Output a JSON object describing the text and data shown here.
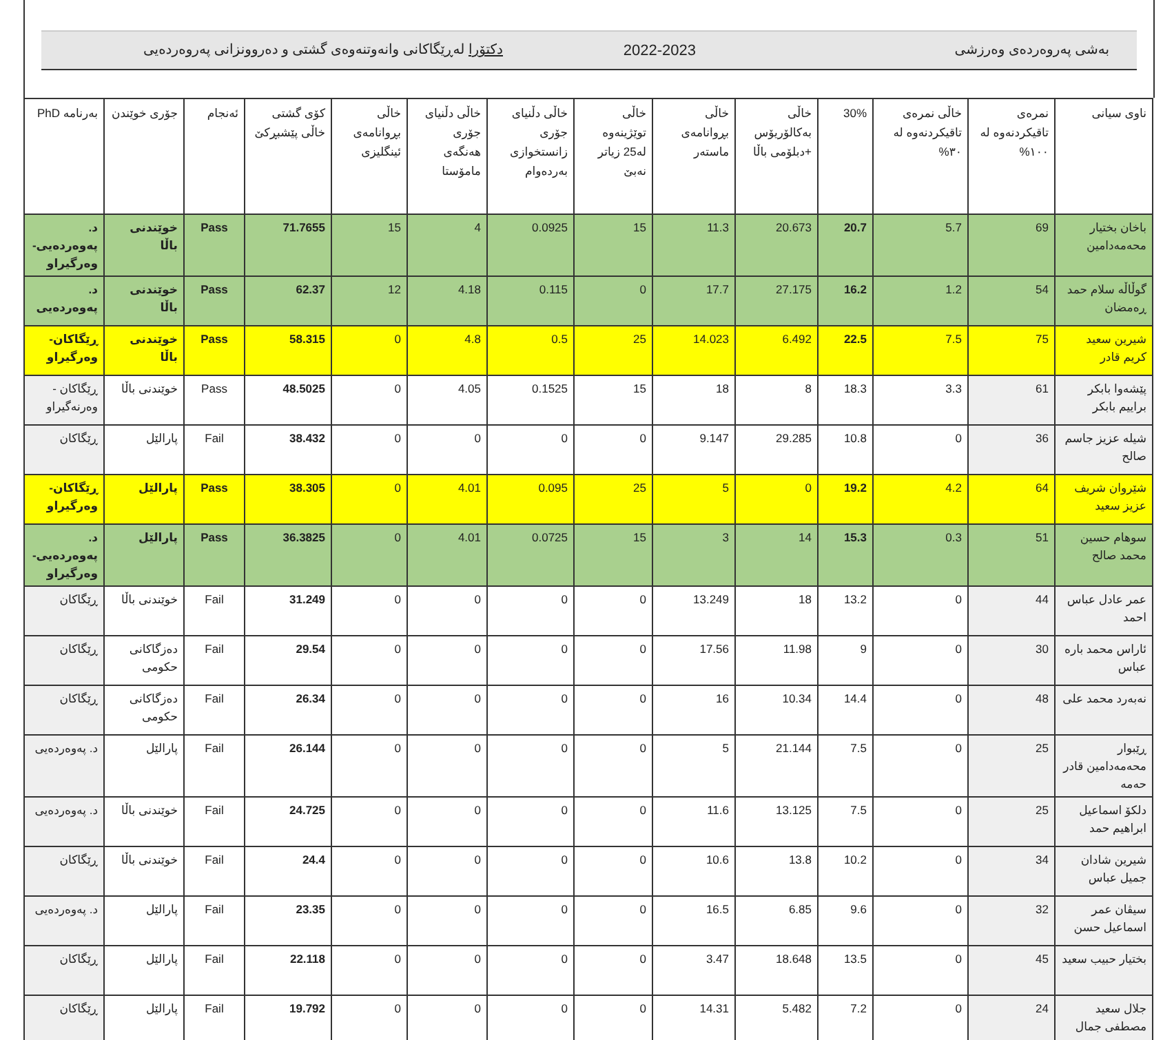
{
  "title_bar": {
    "department": "بەشی پەروەردەی وەرزشی",
    "year": "2022-2023",
    "degree": "دکتۆرا",
    "specialty": "لەڕێگاکانی وانەوتنەوەی گشتی و دەروونزانی پەروەردەیی"
  },
  "table": {
    "columns": [
      "ناوی سیانی",
      "نمرەی تاقیکردنەوە لە ١٠٠%",
      "خاڵی نمرەی تاقیکردنەوە لە ٣٠%",
      "30%",
      "خاڵی بەکالۆریۆس +دبلۆمی باڵا",
      "خاڵی بڕوانامەی ماستەر",
      "خاڵی توێژینەوە لە25 زیاتر نەبێ",
      "خاڵی دڵنیای جۆری زانستخوازی بەردەوام",
      "خاڵی دڵنیای جۆری هەنگەی مامۆستا",
      "خاڵی بڕوانامەی ئینگلیزی",
      "کۆی گشتی خاڵی پێشبڕکێ",
      "ئەنجام",
      "جۆری خوێندن",
      "بەرنامە PhD"
    ],
    "rows": [
      {
        "color": "#a9d08e",
        "cells": [
          "باخان بختیار محەمەدامین",
          "69",
          "5.7",
          "20.7",
          "20.673",
          "11.3",
          "15",
          "0.0925",
          "4",
          "15",
          "71.7655",
          "Pass",
          "خوێندنی باڵا",
          "د. پەوەردەیی- وەرگیراو"
        ]
      },
      {
        "color": "#a9d08e",
        "cells": [
          "گوڵاڵە سلام حمد ڕەمضان",
          "54",
          "1.2",
          "16.2",
          "27.175",
          "17.7",
          "0",
          "0.115",
          "4.18",
          "12",
          "62.37",
          "Pass",
          "خوێندنی باڵا",
          "د. پەوەردەیی"
        ]
      },
      {
        "color": "#ffff00",
        "cells": [
          "شیرین سعید کریم قادر",
          "75",
          "7.5",
          "22.5",
          "6.492",
          "14.023",
          "25",
          "0.5",
          "4.8",
          "0",
          "58.315",
          "Pass",
          "خوێندنی باڵا",
          "ڕێگاکان- وەرگیراو"
        ]
      },
      {
        "cells": [
          "پێشەوا بابکر براییم بابکر",
          "61",
          "3.3",
          "18.3",
          "8",
          "18",
          "15",
          "0.1525",
          "4.05",
          "0",
          "48.5025",
          "Pass",
          "خوێندنی باڵا",
          "ڕێگاکان - وەرنەگیراو"
        ]
      },
      {
        "cells": [
          "شیلە عزیز جاسم صالح",
          "36",
          "0",
          "10.8",
          "29.285",
          "9.147",
          "0",
          "0",
          "0",
          "0",
          "38.432",
          "Fail",
          "پارالێل",
          "ڕێگاکان"
        ]
      },
      {
        "color": "#ffff00",
        "cells": [
          "شێروان شریف عزیز سعید",
          "64",
          "4.2",
          "19.2",
          "0",
          "5",
          "25",
          "0.095",
          "4.01",
          "0",
          "38.305",
          "Pass",
          "پارالێل",
          "ڕێگاکان- وەرگیراو"
        ]
      },
      {
        "color": "#a9d08e",
        "cells": [
          "سوهام حسین محمد صالح",
          "51",
          "0.3",
          "15.3",
          "14",
          "3",
          "15",
          "0.0725",
          "4.01",
          "0",
          "36.3825",
          "Pass",
          "پارالێل",
          "د. پەوەردەیی- وەرگیراو"
        ]
      },
      {
        "cells": [
          "عمر عادل عباس احمد",
          "44",
          "0",
          "13.2",
          "18",
          "13.249",
          "0",
          "0",
          "0",
          "0",
          "31.249",
          "Fail",
          "خوێندنی باڵا",
          "ڕێگاکان"
        ]
      },
      {
        "cells": [
          "ئاراس محمد بارە عباس",
          "30",
          "0",
          "9",
          "11.98",
          "17.56",
          "0",
          "0",
          "0",
          "0",
          "29.54",
          "Fail",
          "دەزگاکانی حکومی",
          "ڕێگاکان"
        ]
      },
      {
        "cells": [
          "نەبەرد محمد علی",
          "48",
          "0",
          "14.4",
          "10.34",
          "16",
          "0",
          "0",
          "0",
          "0",
          "26.34",
          "Fail",
          "دەزگاکانی حکومی",
          "ڕێگاکان"
        ]
      },
      {
        "cells": [
          "ڕێبوار محەمەدامین قادر حەمە",
          "25",
          "0",
          "7.5",
          "21.144",
          "5",
          "0",
          "0",
          "0",
          "0",
          "26.144",
          "Fail",
          "پارالێل",
          "د. پەوەردەیی"
        ]
      },
      {
        "cells": [
          "دلکۆ اسماعیل ابراهیم حمد",
          "25",
          "0",
          "7.5",
          "13.125",
          "11.6",
          "0",
          "0",
          "0",
          "0",
          "24.725",
          "Fail",
          "خوێندنی باڵا",
          "د. پەوەردەیی"
        ]
      },
      {
        "cells": [
          "شیرین شادان جمیل عباس",
          "34",
          "0",
          "10.2",
          "13.8",
          "10.6",
          "0",
          "0",
          "0",
          "0",
          "24.4",
          "Fail",
          "خوێندنی باڵا",
          "ڕێگاکان"
        ]
      },
      {
        "cells": [
          "سیڤان عمر اسماعیل حسن",
          "32",
          "0",
          "9.6",
          "6.85",
          "16.5",
          "0",
          "0",
          "0",
          "0",
          "23.35",
          "Fail",
          "پارالێل",
          "د. پەوەردەیی"
        ]
      },
      {
        "cells": [
          "بختیار حبیب سعید",
          "45",
          "0",
          "13.5",
          "18.648",
          "3.47",
          "0",
          "0",
          "0",
          "0",
          "22.118",
          "Fail",
          "پارالێل",
          "ڕێگاکان"
        ]
      },
      {
        "cells": [
          "جلال سعید مصطفى جمال",
          "24",
          "0",
          "7.2",
          "5.482",
          "14.31",
          "0",
          "0",
          "0",
          "0",
          "19.792",
          "Fail",
          "پارالێل",
          "ڕێگاکان"
        ]
      }
    ]
  }
}
